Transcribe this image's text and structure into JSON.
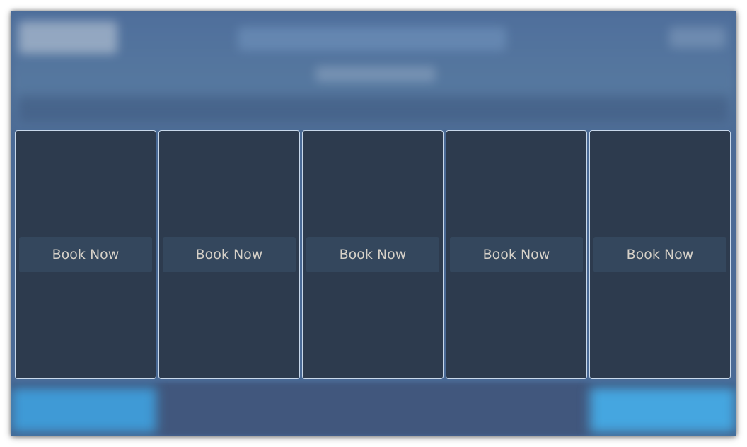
{
  "panels": [
    {
      "button_label": "Book Now"
    },
    {
      "button_label": "Book Now"
    },
    {
      "button_label": "Book Now"
    },
    {
      "button_label": "Book Now"
    },
    {
      "button_label": "Book Now"
    }
  ]
}
